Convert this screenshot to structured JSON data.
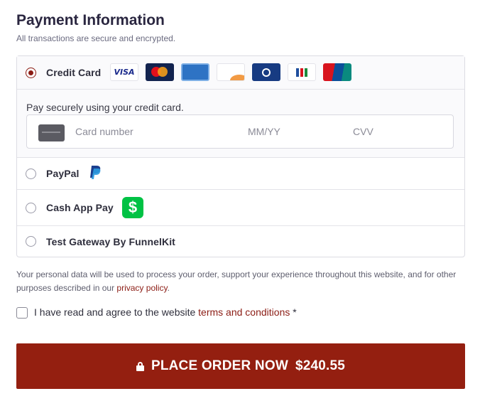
{
  "header": {
    "title": "Payment Information",
    "subtitle": "All transactions are secure and encrypted."
  },
  "payment_methods": {
    "credit_card": {
      "label": "Credit Card",
      "selected": true,
      "card_brands": [
        {
          "name": "VISA",
          "icon": "visa-logo-icon"
        },
        {
          "name": "mastercard",
          "icon": "mastercard-logo-icon"
        },
        {
          "name": "AMERICAN EXPRESS",
          "icon": "amex-logo-icon"
        },
        {
          "name": "DISCOVER",
          "icon": "discover-logo-icon"
        },
        {
          "name": "Diners Club",
          "icon": "diners-club-logo-icon"
        },
        {
          "name": "JCB",
          "icon": "jcb-logo-icon"
        },
        {
          "name": "UnionPay 银联",
          "icon": "unionpay-logo-icon"
        }
      ],
      "description": "Pay securely using your credit card.",
      "card_number_placeholder": "Card number",
      "expiry_placeholder": "MM/YY",
      "cvv_placeholder": "CVV"
    },
    "paypal": {
      "label": "PayPal",
      "selected": false,
      "icon": "paypal-logo-icon"
    },
    "cashapp": {
      "label": "Cash App Pay",
      "selected": false,
      "icon": "cash-app-logo-icon",
      "glyph": "$"
    },
    "test_gateway": {
      "label": "Test Gateway By FunnelKit",
      "selected": false
    }
  },
  "privacy": {
    "text": "Your personal data will be used to process your order, support your experience throughout this website, and for other purposes described in our ",
    "link_text": "privacy policy",
    "suffix": "."
  },
  "terms": {
    "text": "I have read and agree to the website ",
    "link_text": "terms and conditions",
    "required_mark": " *",
    "checked": false
  },
  "place_order": {
    "label": "PLACE ORDER NOW",
    "amount": "$240.55",
    "icon": "lock-icon"
  },
  "colors": {
    "accent": "#941f10",
    "link": "#8b1c14",
    "cash_app_green": "#00c244"
  }
}
